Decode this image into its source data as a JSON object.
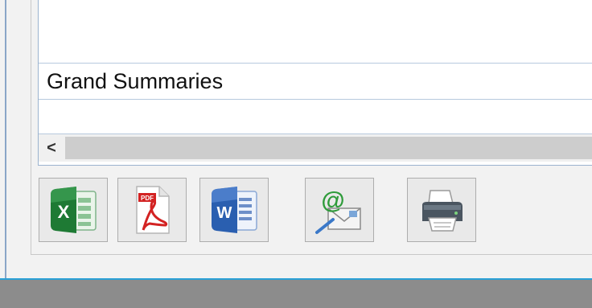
{
  "grid": {
    "grand_summaries_label": "Grand Summaries"
  },
  "scrollbar": {
    "left_arrow_glyph": "<"
  },
  "toolbar": {
    "buttons": [
      {
        "name": "export-excel",
        "icon": "excel-icon"
      },
      {
        "name": "export-pdf",
        "icon": "pdf-icon"
      },
      {
        "name": "export-word",
        "icon": "word-icon"
      },
      {
        "name": "send-email",
        "icon": "email-icon"
      },
      {
        "name": "print",
        "icon": "printer-icon"
      }
    ]
  },
  "colors": {
    "excel_green": "#1e7a34",
    "pdf_red": "#d32222",
    "word_blue": "#2a5fb0",
    "taskbar_accent": "#2aa0d6"
  }
}
